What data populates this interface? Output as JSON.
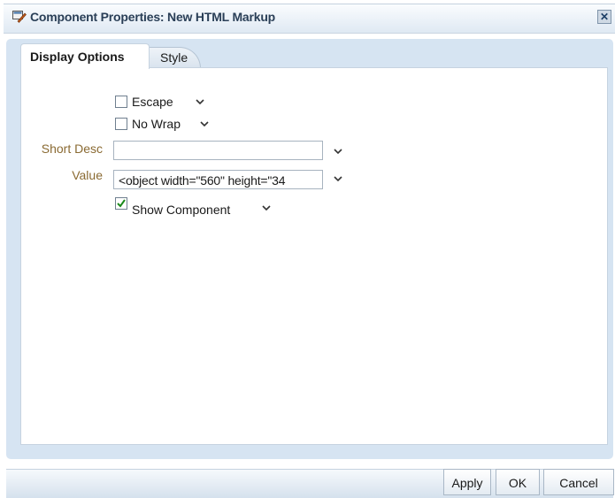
{
  "dialog": {
    "title": "Component Properties: New HTML Markup",
    "close_label": "✕"
  },
  "tabs": [
    {
      "label": "Display Options",
      "active": true
    },
    {
      "label": "Style",
      "active": false
    }
  ],
  "options": {
    "escape": {
      "label": "Escape",
      "checked": false
    },
    "no_wrap": {
      "label": "No Wrap",
      "checked": false
    },
    "show_component": {
      "label": "Show Component",
      "checked": true
    }
  },
  "fields": {
    "short_desc": {
      "label": "Short Desc",
      "value": ""
    },
    "value": {
      "label": "Value",
      "value": "<object width=\"560\" height=\"34"
    }
  },
  "buttons": {
    "apply": "Apply",
    "ok": "OK",
    "cancel": "Cancel"
  },
  "colors": {
    "panel": "#d6e4f2",
    "label_text": "#8a6a32",
    "check": "#1a8a1a"
  }
}
